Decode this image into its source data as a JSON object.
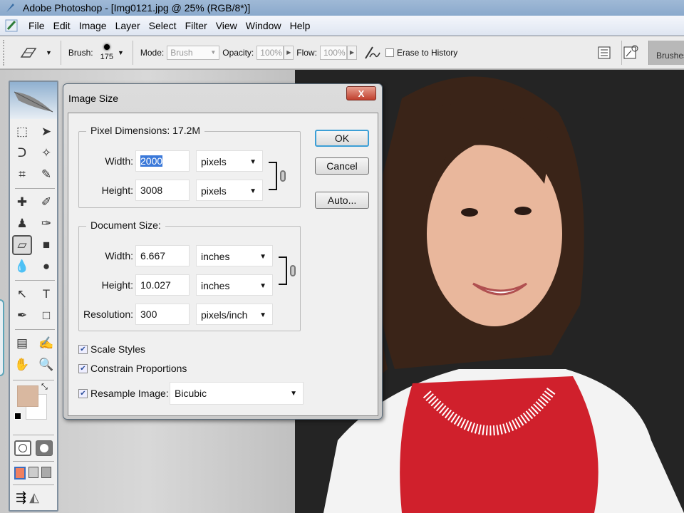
{
  "app": {
    "title": "Adobe Photoshop - [Img0121.jpg @ 25% (RGB/8*)]"
  },
  "menu": [
    "File",
    "Edit",
    "Image",
    "Layer",
    "Select",
    "Filter",
    "View",
    "Window",
    "Help"
  ],
  "options_bar": {
    "tool_icon": "eraser-icon",
    "brush_label": "Brush:",
    "brush_size": "175",
    "mode_label": "Mode:",
    "mode_value": "Brush",
    "opacity_label": "Opacity:",
    "opacity_value": "100%",
    "flow_label": "Flow:",
    "flow_value": "100%",
    "erase_to_history_label": "Erase to History",
    "erase_to_history_checked": false,
    "brushes_tab": "Brushes"
  },
  "toolbox": {
    "tools": [
      {
        "name": "marquee",
        "glyph": "⬚"
      },
      {
        "name": "move",
        "glyph": "➤"
      },
      {
        "name": "lasso",
        "glyph": "ᑐ"
      },
      {
        "name": "magic-wand",
        "glyph": "✧"
      },
      {
        "name": "crop",
        "glyph": "⌗"
      },
      {
        "name": "slice",
        "glyph": "✎"
      },
      {
        "name": "healing-brush",
        "glyph": "✚"
      },
      {
        "name": "brush",
        "glyph": "✐"
      },
      {
        "name": "clone-stamp",
        "glyph": "♟"
      },
      {
        "name": "history-brush",
        "glyph": "✑"
      },
      {
        "name": "eraser",
        "glyph": "▱"
      },
      {
        "name": "gradient",
        "glyph": "■"
      },
      {
        "name": "blur",
        "glyph": "💧"
      },
      {
        "name": "dodge",
        "glyph": "●"
      },
      {
        "name": "path-selection",
        "glyph": "↖"
      },
      {
        "name": "type",
        "glyph": "T"
      },
      {
        "name": "pen",
        "glyph": "✒"
      },
      {
        "name": "shape",
        "glyph": "□"
      },
      {
        "name": "notes",
        "glyph": "▤"
      },
      {
        "name": "eyedropper",
        "glyph": "✍"
      },
      {
        "name": "hand",
        "glyph": "✋"
      },
      {
        "name": "zoom",
        "glyph": "🔍"
      }
    ],
    "foreground_color": "#d9b8a0",
    "background_color": "#ffffff"
  },
  "dialog": {
    "title": "Image Size",
    "pixel_dimensions": {
      "legend": "Pixel Dimensions:",
      "size": "17.2M",
      "width_label": "Width:",
      "width_value": "2000",
      "width_unit": "pixels",
      "height_label": "Height:",
      "height_value": "3008",
      "height_unit": "pixels"
    },
    "document_size": {
      "legend": "Document Size:",
      "width_label": "Width:",
      "width_value": "6.667",
      "width_unit": "inches",
      "height_label": "Height:",
      "height_value": "10.027",
      "height_unit": "inches",
      "resolution_label": "Resolution:",
      "resolution_value": "300",
      "resolution_unit": "pixels/inch"
    },
    "checkboxes": [
      {
        "label": "Scale Styles",
        "checked": true
      },
      {
        "label": "Constrain Proportions",
        "checked": true
      },
      {
        "label": "Resample Image:",
        "checked": true
      }
    ],
    "resample_method": "Bicubic",
    "buttons": {
      "ok": "OK",
      "cancel": "Cancel",
      "auto": "Auto..."
    },
    "close": "X"
  }
}
